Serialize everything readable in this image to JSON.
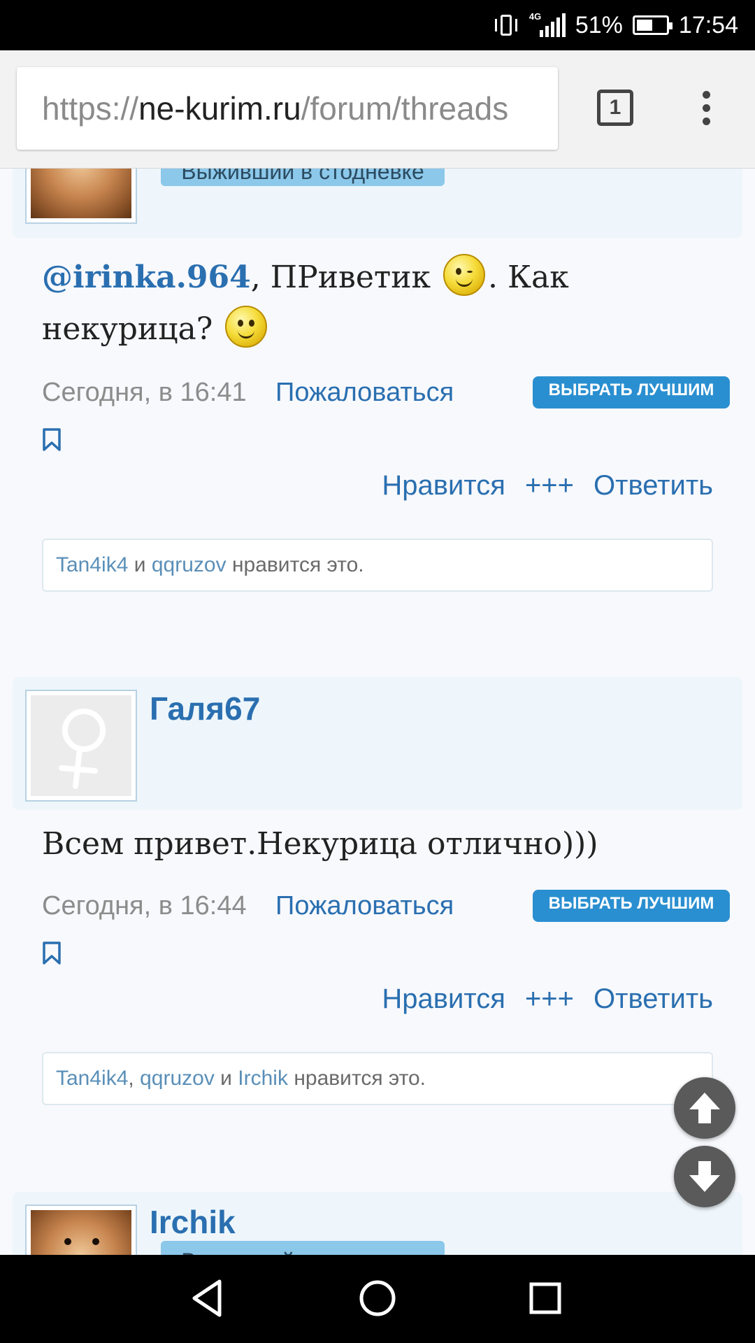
{
  "status_bar": {
    "network": "4G",
    "battery_percent": "51%",
    "battery_level": 0.51,
    "time": "17:54",
    "icons": [
      "vibrate-icon",
      "signal-icon",
      "battery-icon"
    ]
  },
  "browser": {
    "url_scheme": "https://",
    "url_host": "ne-kurim.ru",
    "url_path": "/forum/threads",
    "tab_count": "1",
    "icons": [
      "tab-switcher-icon",
      "menu-icon"
    ]
  },
  "posts": [
    {
      "username": "",
      "rank": "Выживший в стодневке",
      "avatar": "dog-photo",
      "message": {
        "mention": "@irinka.964",
        "part1": ", ПРиветик",
        "part2": ". Как некурица?",
        "smileys": [
          "wink-smiley",
          "happy-smiley"
        ]
      },
      "date": "Сегодня, в 16:41",
      "report": "Пожаловаться",
      "best": "ВЫБРАТЬ ЛУЧШИМ",
      "actions": {
        "like": "Нравится",
        "plus": "+++",
        "reply": "Ответить"
      },
      "likes": {
        "users": [
          "Tan4ik4",
          "qqruzov"
        ],
        "and": "и",
        "suffix": "нравится это."
      }
    },
    {
      "username": "Галя67",
      "avatar": "female-default",
      "message": {
        "text": "Всем привет.Некурица отлично)))"
      },
      "date": "Сегодня, в 16:44",
      "report": "Пожаловаться",
      "best": "ВЫБРАТЬ ЛУЧШИМ",
      "actions": {
        "like": "Нравится",
        "plus": "+++",
        "reply": "Ответить"
      },
      "likes": {
        "users": [
          "Tan4ik4",
          "qqruzov",
          "Irchik"
        ],
        "comma": ",",
        "and": "и",
        "suffix": "нравится это."
      }
    },
    {
      "username": "Irchik",
      "rank": "Выживший в стодневке",
      "avatar": "dog-photo"
    }
  ],
  "scroll_buttons": {
    "up": "scroll-up-icon",
    "down": "scroll-down-icon"
  },
  "nav_bar": [
    "back-icon",
    "home-icon",
    "recents-icon"
  ],
  "colors": {
    "link": "#2a6fb0",
    "best_button": "#2a8fd0",
    "rank_badge": "#8cc8ea",
    "header_bg": "#eef6fb"
  }
}
